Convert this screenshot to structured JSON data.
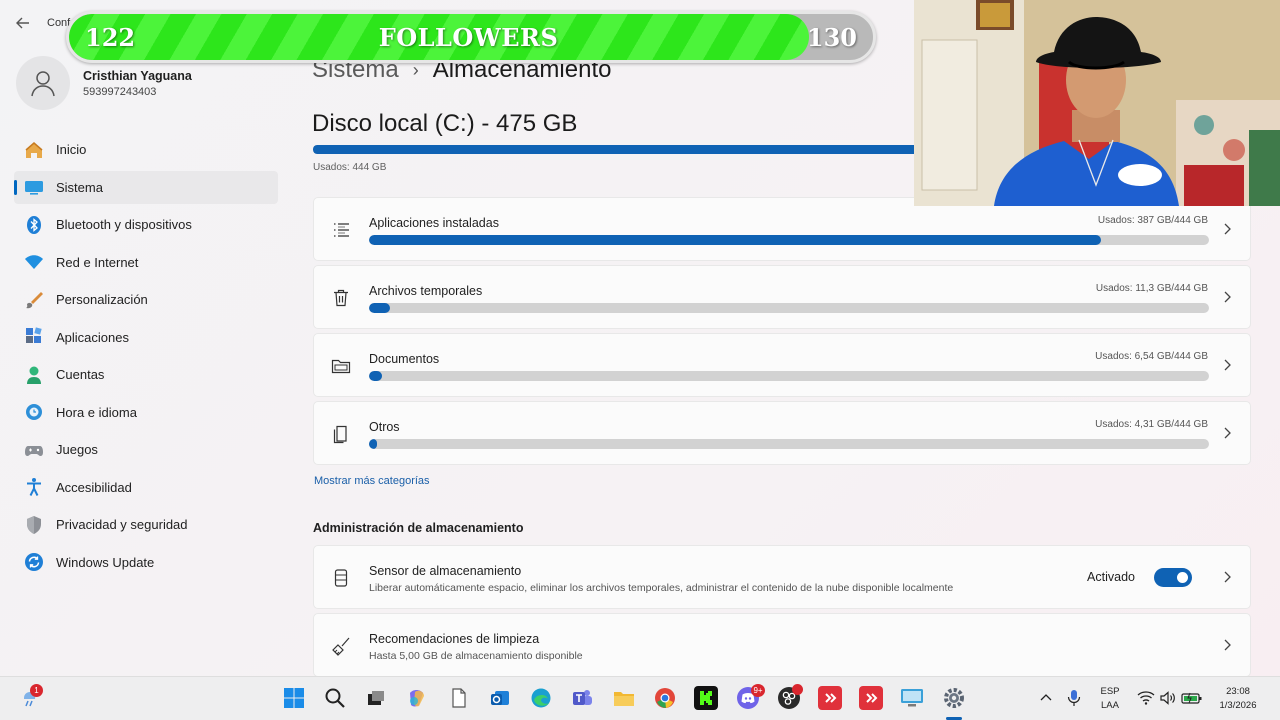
{
  "window": {
    "app_title": "Conf"
  },
  "profile": {
    "name": "Cristhian Yaguana",
    "subtitle": "593997243403"
  },
  "sidebar": {
    "items": [
      {
        "label": "Inicio",
        "icon": "home-icon",
        "active": false
      },
      {
        "label": "Sistema",
        "icon": "system-icon",
        "active": true
      },
      {
        "label": "Bluetooth y dispositivos",
        "icon": "bluetooth-icon",
        "active": false
      },
      {
        "label": "Red e Internet",
        "icon": "wifi-icon",
        "active": false
      },
      {
        "label": "Personalización",
        "icon": "brush-icon",
        "active": false
      },
      {
        "label": "Aplicaciones",
        "icon": "apps-icon",
        "active": false
      },
      {
        "label": "Cuentas",
        "icon": "account-icon",
        "active": false
      },
      {
        "label": "Hora e idioma",
        "icon": "clock-globe-icon",
        "active": false
      },
      {
        "label": "Juegos",
        "icon": "gamepad-icon",
        "active": false
      },
      {
        "label": "Accesibilidad",
        "icon": "accessibility-icon",
        "active": false
      },
      {
        "label": "Privacidad y seguridad",
        "icon": "shield-icon",
        "active": false
      },
      {
        "label": "Windows Update",
        "icon": "update-icon",
        "active": false
      }
    ]
  },
  "breadcrumb": {
    "parent": "Sistema",
    "separator": "›",
    "current": "Almacenamiento"
  },
  "disk": {
    "title": "Disco local (C:) - 475 GB",
    "used_label": "Usados: 444 GB",
    "used_fraction": 0.935
  },
  "categories": [
    {
      "label": "Aplicaciones instaladas",
      "used": "Usados: 387 GB/444 GB",
      "fraction": 0.871,
      "icon": "list-icon"
    },
    {
      "label": "Archivos temporales",
      "used": "Usados: 11,3 GB/444 GB",
      "fraction": 0.025,
      "icon": "trash-icon"
    },
    {
      "label": "Documentos",
      "used": "Usados: 6,54 GB/444 GB",
      "fraction": 0.015,
      "icon": "folder-icon"
    },
    {
      "label": "Otros",
      "used": "Usados: 4,31 GB/444 GB",
      "fraction": 0.01,
      "icon": "document-icon"
    }
  ],
  "more_link": "Mostrar más categorías",
  "management": {
    "heading": "Administración de almacenamiento",
    "sensor": {
      "title": "Sensor de almacenamiento",
      "description": "Liberar automáticamente espacio, eliminar los archivos temporales, administrar el contenido de la nube disponible localmente",
      "toggle_label": "Activado",
      "toggle_on": true
    },
    "cleanup": {
      "title": "Recomendaciones de limpieza",
      "description": "Hasta 5,00 GB de almacenamiento disponible"
    }
  },
  "overlay": {
    "left_count": "122",
    "label": "FOLLOWERS",
    "right_count": "130",
    "progress": 0.92
  },
  "taskbar": {
    "weather_badge": "1",
    "discord_badge": "9+",
    "lang_top": "ESP",
    "lang_bottom": "LAA",
    "time": "23:08",
    "date": "1/3/2026"
  },
  "colors": {
    "accent": "#0f62b4",
    "overlay_green": "#2de61b",
    "taskbar_bg": "#eeeeef"
  }
}
